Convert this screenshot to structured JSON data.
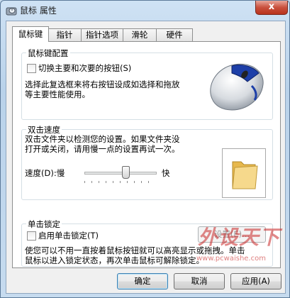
{
  "window": {
    "title": "鼠标 属性",
    "close_glyph": "x"
  },
  "tabs": [
    {
      "label": "鼠标键"
    },
    {
      "label": "指针"
    },
    {
      "label": "指针选项"
    },
    {
      "label": "滑轮"
    },
    {
      "label": "硬件"
    }
  ],
  "button_config": {
    "legend": "鼠标键配置",
    "swap_label": "切换主要和次要的按钮(S)",
    "swap_checked": false,
    "description_line1": "选择此复选框来将右按钮设成如选择和拖放",
    "description_line2": "等主要性能使用。"
  },
  "double_click": {
    "legend": "双击速度",
    "description_line1": "双击文件夹以检测您的设置。如果文件夹没",
    "description_line2": "打开或关闭，请用慢一点的设置再试一次。",
    "speed_label": "速度(D):慢",
    "fast_label": "快",
    "speed_value": 0.6
  },
  "click_lock": {
    "legend": "单击锁定",
    "enable_label": "启用单击锁定(T)",
    "enable_checked": false,
    "settings_button": "设置(E)...",
    "description_line1": "使您可以不用一直按着鼠标按钮就可以高亮显示或拖拽。单击",
    "description_line2": "鼠标以进入锁定状态，再次单击鼠标可解除锁定。"
  },
  "footer": {
    "ok": "确定",
    "cancel": "取消",
    "apply": "应用(A)"
  },
  "watermark": {
    "text": "外设天下",
    "url": "www.pcwaishe.com"
  }
}
